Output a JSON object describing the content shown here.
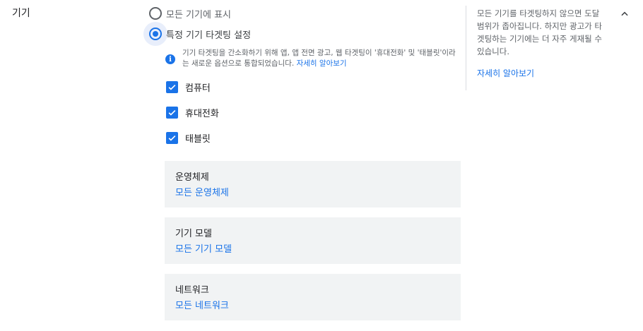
{
  "section": {
    "title": "기기"
  },
  "radio_options": [
    {
      "label": "모든 기기에 표시",
      "checked": false
    },
    {
      "label": "특정 기기 타겟팅 설정",
      "checked": true
    }
  ],
  "info": {
    "text": "기기 타겟팅을 간소화하기 위해 앱, 앱 전면 광고, 웹 타겟팅이 '휴대전화' 및 '태블릿'이라는 새로운 옵션으로 통합되었습니다. ",
    "link": "자세히 알아보기"
  },
  "devices": [
    {
      "label": "컴퓨터",
      "checked": true
    },
    {
      "label": "휴대전화",
      "checked": true
    },
    {
      "label": "태블릿",
      "checked": true
    }
  ],
  "panels": [
    {
      "title": "운영체제",
      "value": "모든 운영체제"
    },
    {
      "title": "기기 모델",
      "value": "모든 기기 모델"
    },
    {
      "title": "네트워크",
      "value": "모든 네트워크"
    }
  ],
  "help": {
    "text": "모든 기기를 타겟팅하지 않으면 도달범위가 좁아집니다. 하지만 광고가 타겟팅하는 기기에는 더 자주 게재될 수 있습니다.",
    "link": "자세히 알아보기"
  },
  "icons": {
    "collapse": "chevron-up-icon",
    "info": "info-icon",
    "check": "check-icon"
  },
  "colors": {
    "accent": "#1a73e8",
    "panel_bg": "#f1f3f4"
  }
}
